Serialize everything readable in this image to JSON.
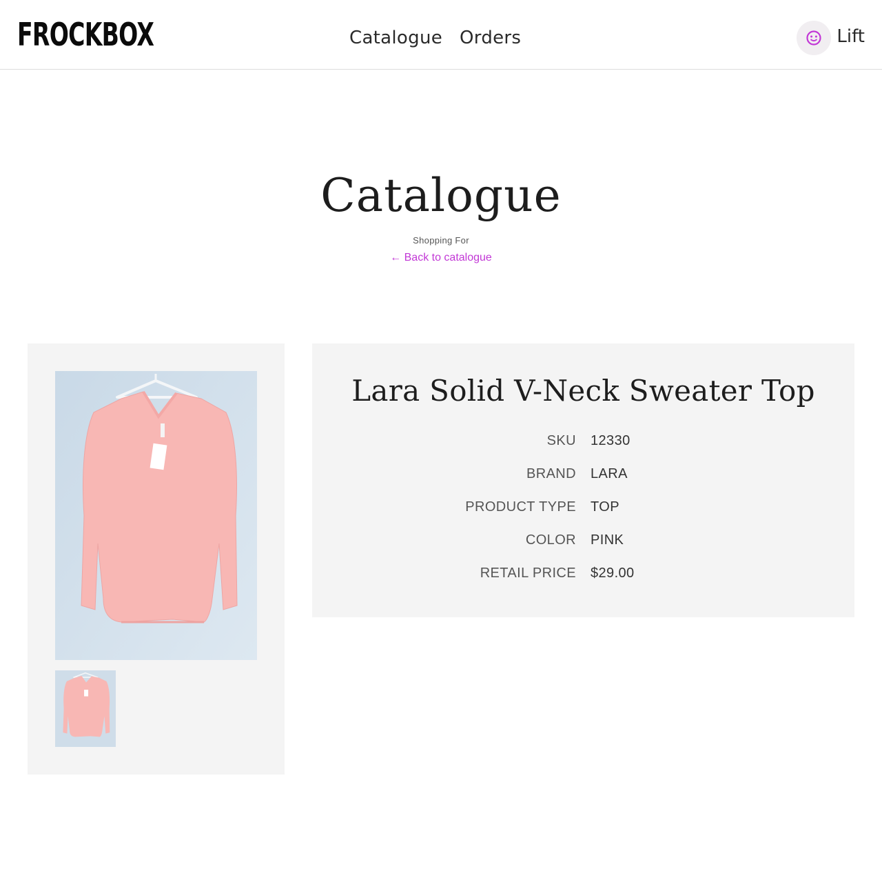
{
  "header": {
    "logo_text": "FROCKBOX",
    "nav": [
      {
        "label": "Catalogue"
      },
      {
        "label": "Orders"
      }
    ],
    "user": {
      "name": "Lift",
      "avatar_icon": "smiley-face-icon"
    }
  },
  "page": {
    "title": "Catalogue",
    "shopping_for_label": "Shopping For",
    "back_link": "← Back to catalogue"
  },
  "product": {
    "name": "Lara Solid V-Neck Sweater Top",
    "main_image_icon": "pink-sweater-on-hanger-photo",
    "thumbnail_icon": "pink-sweater-on-hanger-photo",
    "specs": [
      {
        "label": "SKU",
        "value": "12330"
      },
      {
        "label": "BRAND",
        "value": "LARA"
      },
      {
        "label": "PRODUCT TYPE",
        "value": "TOP"
      },
      {
        "label": "COLOR",
        "value": "PINK"
      },
      {
        "label": "RETAIL PRICE",
        "value": "$29.00"
      }
    ]
  },
  "colors": {
    "accent": "#c238d6",
    "panel_background": "#f4f4f4",
    "photo_background": "#cfdde9",
    "sweater": "#f8b7b4"
  }
}
